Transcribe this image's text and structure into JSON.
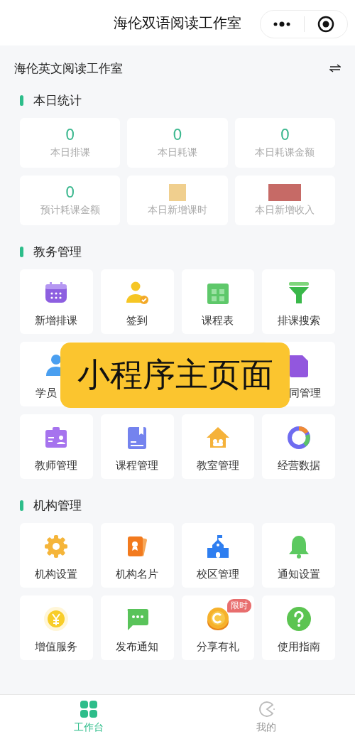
{
  "header": {
    "title": "海伦双语阅读工作室"
  },
  "org": {
    "name": "海伦英文阅读工作室"
  },
  "stats": {
    "title": "本日统计",
    "items": [
      {
        "kind": "number",
        "value": "0",
        "label": "本日排课"
      },
      {
        "kind": "number",
        "value": "0",
        "label": "本日耗课"
      },
      {
        "kind": "number",
        "value": "0",
        "label": "本日耗课金额"
      },
      {
        "kind": "number",
        "value": "0",
        "label": "预计耗课金额"
      },
      {
        "kind": "redacted",
        "color": "#f0cf8e",
        "label": "本日新增课时"
      },
      {
        "kind": "redacted",
        "color": "#c66a66",
        "label": "本日新增收入"
      }
    ]
  },
  "sections": [
    {
      "title": "教务管理",
      "overlay": {
        "text": "小程序主页面"
      },
      "items": [
        {
          "kind": "tile",
          "label": "新增排课"
        },
        {
          "kind": "tile",
          "label": "签到"
        },
        {
          "kind": "tile",
          "label": "课程表"
        },
        {
          "kind": "tile",
          "label": "排课搜索"
        },
        {
          "kind": "cut_right",
          "label": "学员"
        },
        {
          "kind": "covered"
        },
        {
          "kind": "covered"
        },
        {
          "kind": "cut_left",
          "label": "同管理"
        },
        {
          "kind": "tile",
          "label": "教师管理"
        },
        {
          "kind": "tile",
          "label": "课程管理"
        },
        {
          "kind": "tile",
          "label": "教室管理"
        },
        {
          "kind": "tile",
          "label": "经营数据"
        }
      ]
    },
    {
      "title": "机构管理",
      "items": [
        {
          "kind": "tile",
          "label": "机构设置"
        },
        {
          "kind": "tile",
          "label": "机构名片"
        },
        {
          "kind": "tile",
          "label": "校区管理"
        },
        {
          "kind": "tile",
          "label": "通知设置"
        },
        {
          "kind": "tile",
          "label": "增值服务"
        },
        {
          "kind": "tile",
          "label": "发布通知"
        },
        {
          "kind": "tile",
          "label": "分享有礼",
          "badge": "限时"
        },
        {
          "kind": "tile",
          "label": "使用指南"
        }
      ]
    }
  ],
  "tabbar": [
    {
      "label": "工作台",
      "selected": true
    },
    {
      "label": "我的",
      "selected": false
    }
  ]
}
